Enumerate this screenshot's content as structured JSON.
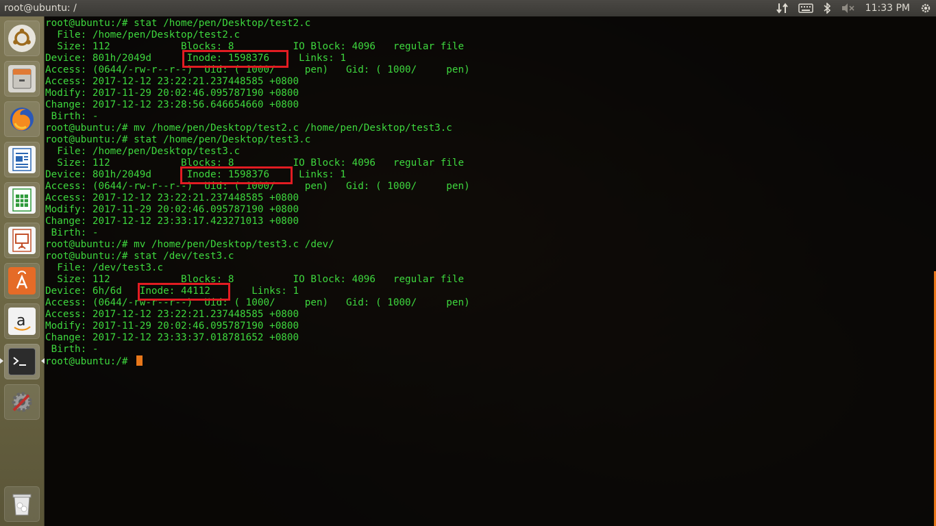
{
  "panel": {
    "window_title": "root@ubuntu: /",
    "clock": "11:33 PM",
    "indicators": [
      "network-icon",
      "keyboard-icon",
      "bluetooth-icon",
      "volume-muted-icon",
      "power-gear-icon"
    ]
  },
  "launcher": {
    "items": [
      "ubuntu-dash",
      "files",
      "firefox",
      "libreoffice-writer",
      "libreoffice-calc",
      "libreoffice-impress",
      "ubuntu-software",
      "amazon",
      "terminal",
      "system-settings",
      "trash"
    ]
  },
  "terminal": {
    "prompt": "root@ubuntu:/# ",
    "lines": [
      "root@ubuntu:/# stat /home/pen/Desktop/test2.c",
      "  File: /home/pen/Desktop/test2.c",
      "  Size: 112            Blocks: 8          IO Block: 4096   regular file",
      "Device: 801h/2049d      Inode: 1598376     Links: 1",
      "Access: (0644/-rw-r--r--)  Uid: ( 1000/     pen)   Gid: ( 1000/     pen)",
      "Access: 2017-12-12 23:22:21.237448585 +0800",
      "Modify: 2017-11-29 20:02:46.095787190 +0800",
      "Change: 2017-12-12 23:28:56.646654660 +0800",
      " Birth: -",
      "root@ubuntu:/# mv /home/pen/Desktop/test2.c /home/pen/Desktop/test3.c",
      "root@ubuntu:/# stat /home/pen/Desktop/test3.c",
      "  File: /home/pen/Desktop/test3.c",
      "  Size: 112            Blocks: 8          IO Block: 4096   regular file",
      "Device: 801h/2049d      Inode: 1598376     Links: 1",
      "Access: (0644/-rw-r--r--)  Uid: ( 1000/     pen)   Gid: ( 1000/     pen)",
      "Access: 2017-12-12 23:22:21.237448585 +0800",
      "Modify: 2017-11-29 20:02:46.095787190 +0800",
      "Change: 2017-12-12 23:33:17.423271013 +0800",
      " Birth: -",
      "root@ubuntu:/# mv /home/pen/Desktop/test3.c /dev/",
      "root@ubuntu:/# stat /dev/test3.c",
      "  File: /dev/test3.c",
      "  Size: 112            Blocks: 8          IO Block: 4096   regular file",
      "Device: 6h/6d   Inode: 44112       Links: 1",
      "Access: (0644/-rw-r--r--)  Uid: ( 1000/     pen)   Gid: ( 1000/     pen)",
      "Access: 2017-12-12 23:22:21.237448585 +0800",
      "Modify: 2017-11-29 20:02:46.095787190 +0800",
      "Change: 2017-12-12 23:33:37.018781652 +0800",
      " Birth: -"
    ],
    "text_color": "#3ed83e",
    "cursor_color": "#e8771a",
    "highlight_color": "#e21c22"
  }
}
